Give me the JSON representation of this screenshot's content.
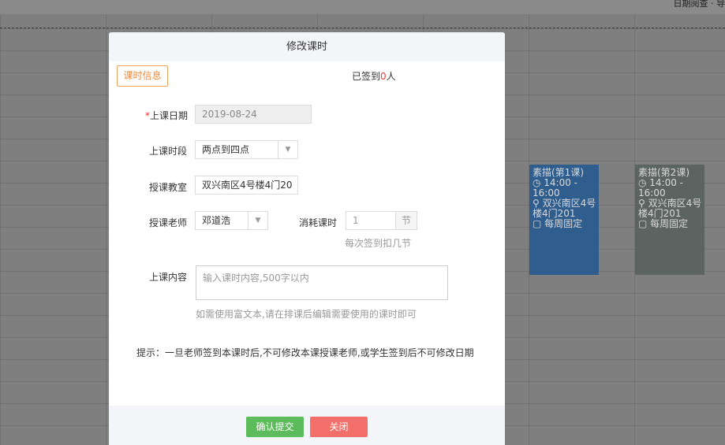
{
  "background": {
    "top_right_text": "日期阅查 · 导",
    "cards": [
      {
        "lines": [
          "素描(第1课)",
          "◷ 14:00 -",
          "16:00",
          "⚲ 双兴南区4号",
          "楼4门201",
          "▢ 每周固定"
        ]
      },
      {
        "lines": [
          "素描(第2课)",
          "◷ 14:00 -",
          "16:00",
          "⚲ 双兴南区4号",
          "楼4门201",
          "▢ 每周固定"
        ]
      }
    ]
  },
  "modal": {
    "title": "修改课时",
    "tab_label": "课时信息",
    "signed_prefix": "已签到",
    "signed_count": "0",
    "signed_suffix": "人",
    "date": {
      "required_mark": "*",
      "label": "上课日期",
      "value": "2019-08-24"
    },
    "period": {
      "label": "上课时段",
      "value": "两点到四点"
    },
    "classroom": {
      "label": "授课教室",
      "value": "双兴南区4号楼4门20"
    },
    "teacher": {
      "label": "授课老师",
      "value": "邓道浩"
    },
    "consume": {
      "label": "消耗课时",
      "value": "1",
      "unit": "节",
      "hint": "每次签到扣几节"
    },
    "content": {
      "label": "上课内容",
      "placeholder": "输入课时内容,500字以内",
      "hint": "如需使用富文本,请在排课后编辑需要使用的课时即可"
    },
    "tip": "提示：一旦老师签到本课时后,不可修改本课授课老师,或学生签到后不可修改日期",
    "confirm_label": "确认提交",
    "close_label": "关闭"
  }
}
